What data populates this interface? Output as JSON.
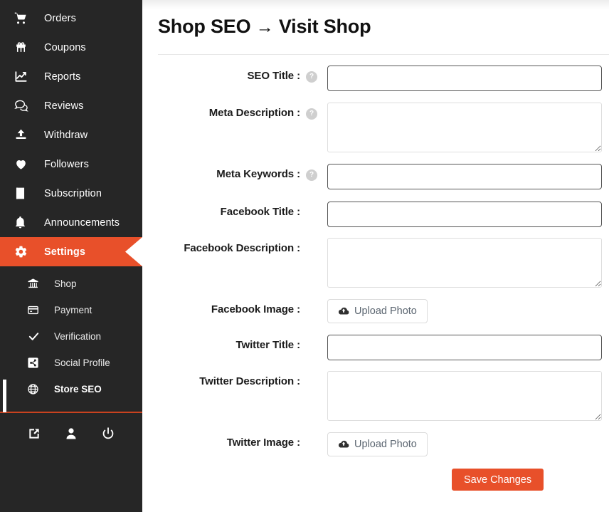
{
  "sidebar": {
    "items": [
      {
        "label": "Orders",
        "icon": "shopping-cart-icon"
      },
      {
        "label": "Coupons",
        "icon": "gift-icon"
      },
      {
        "label": "Reports",
        "icon": "chart-line-icon"
      },
      {
        "label": "Reviews",
        "icon": "comments-icon"
      },
      {
        "label": "Withdraw",
        "icon": "upload-icon"
      },
      {
        "label": "Followers",
        "icon": "heart-icon"
      },
      {
        "label": "Subscription",
        "icon": "book-icon"
      },
      {
        "label": "Announcements",
        "icon": "bell-icon"
      },
      {
        "label": "Settings",
        "icon": "gear-icon"
      }
    ],
    "submenu": [
      {
        "label": "Shop",
        "icon": "bank-icon"
      },
      {
        "label": "Payment",
        "icon": "credit-card-icon"
      },
      {
        "label": "Verification",
        "icon": "check-icon"
      },
      {
        "label": "Social Profile",
        "icon": "share-icon"
      },
      {
        "label": "Store SEO",
        "icon": "globe-icon"
      }
    ],
    "footer_icons": [
      {
        "name": "external-link-icon"
      },
      {
        "name": "user-icon"
      },
      {
        "name": "power-off-icon"
      }
    ],
    "active_item": "Settings",
    "current_subitem": "Store SEO",
    "accent_color": "#e8502a",
    "background_color": "#262626"
  },
  "header": {
    "title": "Shop SEO",
    "arrow": "→",
    "link": "Visit Shop"
  },
  "form": {
    "seo_title": {
      "label": "SEO Title :",
      "value": "",
      "placeholder": ""
    },
    "meta_description": {
      "label": "Meta Description :",
      "value": "",
      "placeholder": ""
    },
    "meta_keywords": {
      "label": "Meta Keywords :",
      "value": "",
      "placeholder": ""
    },
    "facebook_title": {
      "label": "Facebook Title :",
      "value": "",
      "placeholder": ""
    },
    "facebook_description": {
      "label": "Facebook Description :",
      "value": "",
      "placeholder": ""
    },
    "facebook_image": {
      "label": "Facebook Image :",
      "button": "Upload Photo"
    },
    "twitter_title": {
      "label": "Twitter Title :",
      "value": "",
      "placeholder": ""
    },
    "twitter_description": {
      "label": "Twitter Description :",
      "value": "",
      "placeholder": ""
    },
    "twitter_image": {
      "label": "Twitter Image :",
      "button": "Upload Photo"
    },
    "help_glyph": "?",
    "save_label": "Save Changes"
  }
}
